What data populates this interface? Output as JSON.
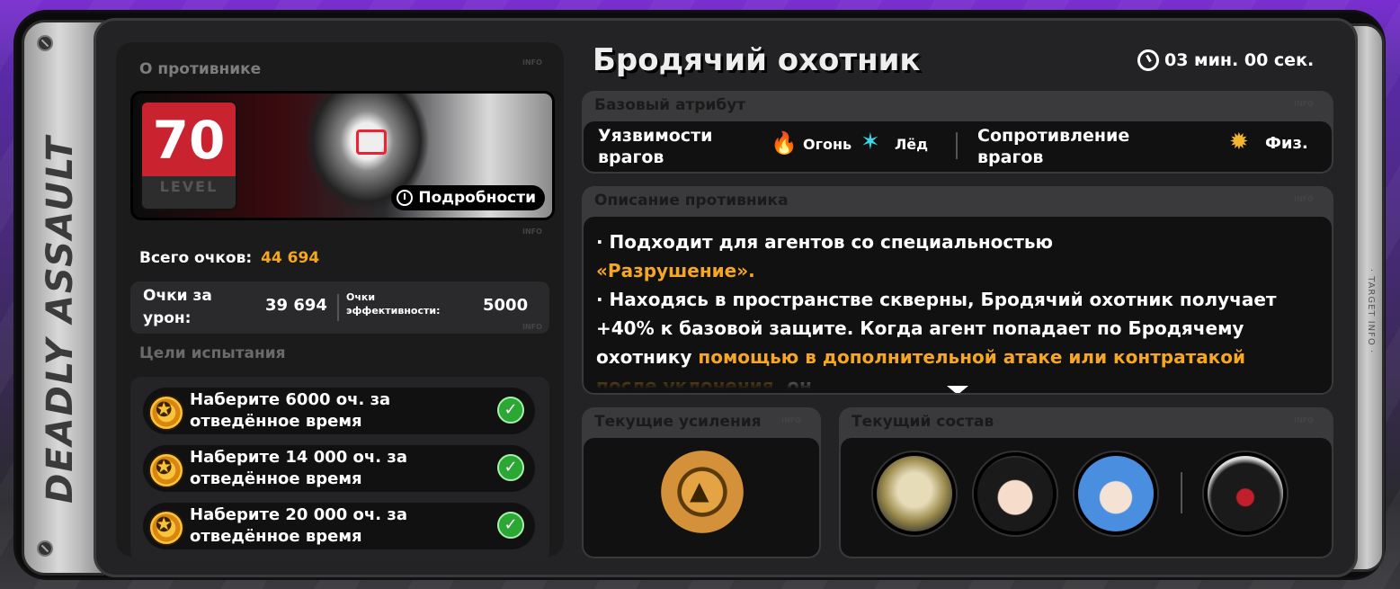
{
  "side": {
    "title": "DEADLY ASSAULT",
    "right_label": "· TARGET INFO ·"
  },
  "info_tag": "INFO",
  "enemy": {
    "section_label": "О противнике",
    "level": "70",
    "level_label": "LEVEL",
    "details_label": "Подробности",
    "name": "Бродячий охотник"
  },
  "timer": "03 мин. 00 сек.",
  "scores": {
    "total_label": "Всего очков:",
    "total_value": "44 694",
    "damage_label": "Очки за урон:",
    "damage_value": "39 694",
    "efficiency_label": "Очки эффективности:",
    "efficiency_value": "5000"
  },
  "goals": {
    "section_label": "Цели испытания",
    "items": [
      {
        "text": "Наберите 6000 оч. за отведённое время",
        "completed": true
      },
      {
        "text": "Наберите 14 000 оч. за отведённое время",
        "completed": true
      },
      {
        "text": "Наберите 20 000 оч. за отведённое время",
        "completed": true
      }
    ],
    "check_glyph": "✓"
  },
  "attributes": {
    "section_label": "Базовый атрибут",
    "weakness_label": "Уязвимости врагов",
    "weaknesses": [
      {
        "name": "Огонь",
        "icon": "fire-icon",
        "color": "#f0522b",
        "glyph": "🔥"
      },
      {
        "name": "Лёд",
        "icon": "ice-icon",
        "color": "#3fd6e8",
        "glyph": "✶"
      }
    ],
    "resistance_label": "Сопротивление врагов",
    "resistances": [
      {
        "name": "Физ.",
        "icon": "physical-icon",
        "color": "#f2b530",
        "glyph": "✹"
      }
    ]
  },
  "description": {
    "section_label": "Описание противника",
    "p1_text": "· Подходит для агентов со специальностью",
    "p1_highlight": "«Разрушение».",
    "p2_text": "· Находясь в пространстве скверны, Бродячий охотник получает +40% к базовой защите. Когда агент попадает по Бродячему охотнику",
    "p2_highlight": "помощью в дополнительной атаке или контратакой после уклонения,",
    "p2_tail": "он"
  },
  "buffs": {
    "section_label": "Текущие усиления"
  },
  "team": {
    "section_label": "Текущий состав",
    "members": [
      "agent-1",
      "agent-2",
      "agent-3",
      "bangboo"
    ]
  },
  "colors": {
    "accent": "#f5a623",
    "level_bg": "#c8232f",
    "check": "#2ca634"
  }
}
